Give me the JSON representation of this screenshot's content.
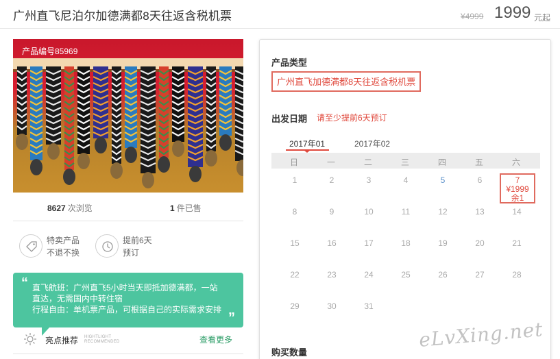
{
  "header": {
    "title": "广州直飞尼泊尔加德满都8天往返含税机票",
    "old_price": "¥4999",
    "price": "1999",
    "price_unit": "元起"
  },
  "product": {
    "code_label": "产品编号85969",
    "views_count": "8627",
    "views_label": "次浏览",
    "sold_count": "1",
    "sold_label": "件已售"
  },
  "features": [
    {
      "icon": "tag-icon",
      "line1": "特卖产品",
      "line2": "不退不换"
    },
    {
      "icon": "clock-icon",
      "line1": "提前6天",
      "line2": "预订"
    }
  ],
  "note": {
    "open_quote": "“",
    "close_quote": "”",
    "line1": "直飞航班：广州直飞5小时当天即抵加德满都，一站",
    "line2": "直达，无需国内中转住宿",
    "line3": "行程自由：单机票产品，可根据自己的实际需求安排"
  },
  "highlight": {
    "title": "亮点推荐",
    "en_line1": "HIGHTLIGHT",
    "en_line2": "RECOMMENDED",
    "more_link": "查看更多"
  },
  "booking": {
    "product_type_label": "产品类型",
    "product_type_option": "广州直飞加德满都8天往返含税机票",
    "departure_label": "出发日期",
    "departure_hint": "请至少提前6天预订",
    "months": [
      "2017年01",
      "2017年02"
    ],
    "weekdays": [
      "日",
      "一",
      "二",
      "三",
      "四",
      "五",
      "六"
    ],
    "selected_day": {
      "day": "7",
      "price": "¥1999",
      "stock": "余1"
    },
    "days": {
      "d1": "1",
      "d2": "2",
      "d3": "3",
      "d4": "4",
      "d5": "5",
      "d6": "6",
      "d8": "8",
      "d9": "9",
      "d10": "10",
      "d11": "11",
      "d12": "12",
      "d13": "13",
      "d14": "14",
      "d15": "15",
      "d16": "16",
      "d17": "17",
      "d18": "18",
      "d19": "19",
      "d20": "20",
      "d21": "21",
      "d22": "22",
      "d23": "23",
      "d24": "24",
      "d25": "25",
      "d26": "26",
      "d27": "27",
      "d28": "28",
      "d29": "29",
      "d30": "30",
      "d31": "31"
    },
    "quantity_label": "购买数量"
  },
  "watermark": "eLvXing.net",
  "colors": {
    "accent_red": "#e0493d",
    "note_green": "#4dc59f",
    "link_green": "#2e9e68"
  }
}
